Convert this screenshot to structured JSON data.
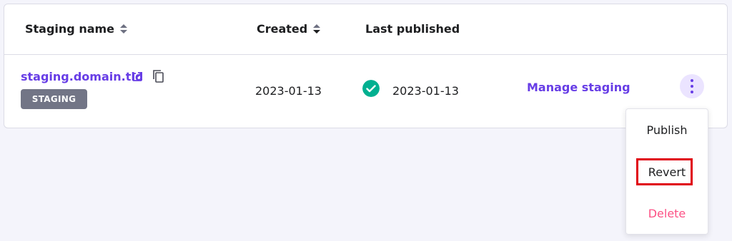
{
  "table": {
    "columns": [
      {
        "label": "Staging name",
        "sortable": true
      },
      {
        "label": "Created",
        "sortable": true
      },
      {
        "label": "Last published",
        "sortable": false
      }
    ],
    "row": {
      "staging_name": "staging.domain.tld",
      "badge": "STAGING",
      "created": "2023-01-13",
      "last_published": "2023-01-13",
      "published_status": "success",
      "manage_label": "Manage staging"
    }
  },
  "dropdown": {
    "items": [
      {
        "label": "Publish"
      },
      {
        "label": "Revert",
        "highlighted": true
      },
      {
        "label": "Delete",
        "danger": true
      }
    ]
  },
  "colors": {
    "accent": "#673de6",
    "success": "#00b090",
    "danger": "#fc5185",
    "badge": "#727586",
    "highlight": "#e0000f"
  },
  "icons": [
    "sort-icon",
    "external-link-icon",
    "copy-icon",
    "check-circle-icon",
    "more-vertical-icon"
  ]
}
